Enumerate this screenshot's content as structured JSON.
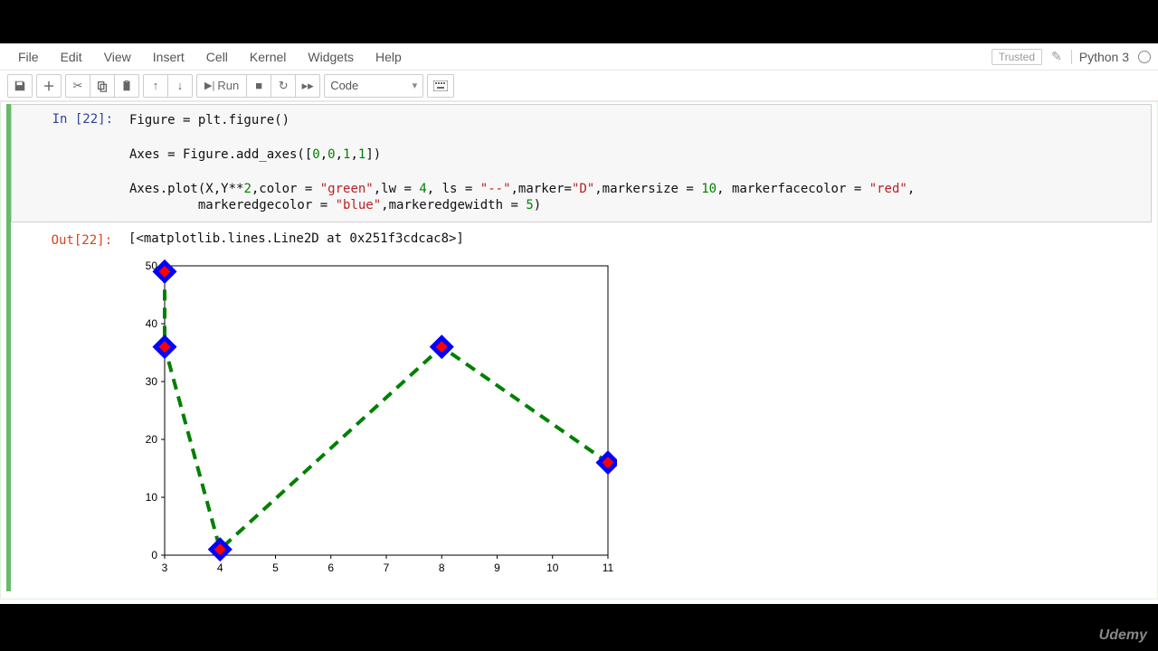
{
  "menu": {
    "file": "File",
    "edit": "Edit",
    "view": "View",
    "insert": "Insert",
    "cell": "Cell",
    "kernel": "Kernel",
    "widgets": "Widgets",
    "help": "Help"
  },
  "status": {
    "trusted": "Trusted",
    "kernel": "Python 3"
  },
  "toolbar": {
    "run": "Run",
    "celltype": "Code"
  },
  "cell": {
    "in_prompt": "In [22]:",
    "out_prompt": "Out[22]:",
    "out_text": "[<matplotlib.lines.Line2D at 0x251f3cdcac8>]"
  },
  "code_plain": "Figure = plt.figure()\n\nAxes = Figure.add_axes([0,0,1,1])\n\nAxes.plot(X,Y**2,color = \"green\",lw = 4, ls = \"--\",marker=\"D\",markersize = 10, markerfacecolor = \"red\",\n         markeredgecolor = \"blue\",markeredgewidth = 5)",
  "chart_data": {
    "type": "line",
    "x": [
      3,
      3,
      4,
      8,
      11
    ],
    "y": [
      49,
      36,
      1,
      36,
      16
    ],
    "xticks": [
      3,
      4,
      5,
      6,
      7,
      8,
      9,
      10,
      11
    ],
    "yticks": [
      0,
      10,
      20,
      30,
      40,
      50
    ],
    "xlim": [
      3,
      11
    ],
    "ylim": [
      0,
      50
    ],
    "line_color": "green",
    "line_width": 4,
    "line_style": "dashed",
    "marker": "D",
    "marker_size": 10,
    "marker_face": "red",
    "marker_edge": "blue",
    "marker_edge_width": 5
  },
  "brand": "Udemy"
}
